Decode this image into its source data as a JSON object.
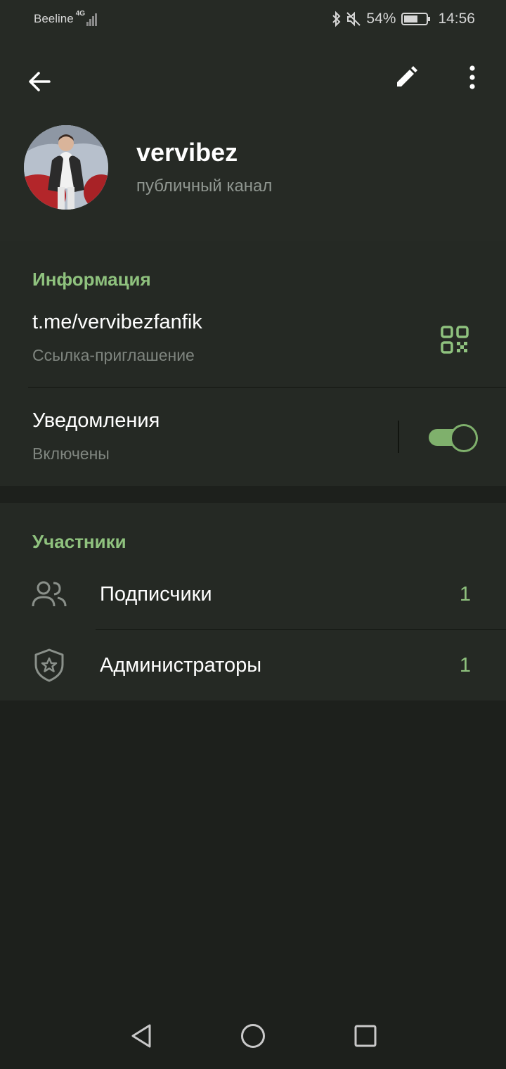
{
  "status_bar": {
    "carrier": "Beeline",
    "network_type": "4G",
    "battery_percent": "54%",
    "time": "14:56",
    "icons": [
      "bluetooth-icon",
      "mute-icon",
      "battery-icon",
      "signal-icon"
    ]
  },
  "header": {
    "channel_name": "vervibez",
    "channel_type": "публичный канал",
    "icons": [
      "back-arrow-icon",
      "pencil-icon",
      "more-vertical-icon"
    ]
  },
  "info": {
    "title": "Информация",
    "link": "t.me/vervibezfanfik",
    "link_label": "Ссылка-приглашение",
    "notifications_title": "Уведомления",
    "notifications_status": "Включены",
    "notifications_enabled": true
  },
  "members": {
    "title": "Участники",
    "rows": [
      {
        "label": "Подписчики",
        "count": "1",
        "icon": "people-icon"
      },
      {
        "label": "Администраторы",
        "count": "1",
        "icon": "shield-star-icon"
      }
    ]
  },
  "colors": {
    "accent": "#8fc27e",
    "background": "#1d201c",
    "surface": "#252924",
    "header": "#262a25"
  },
  "nav": {
    "icons": [
      "back-triangle-icon",
      "home-circle-icon",
      "recents-square-icon"
    ]
  }
}
